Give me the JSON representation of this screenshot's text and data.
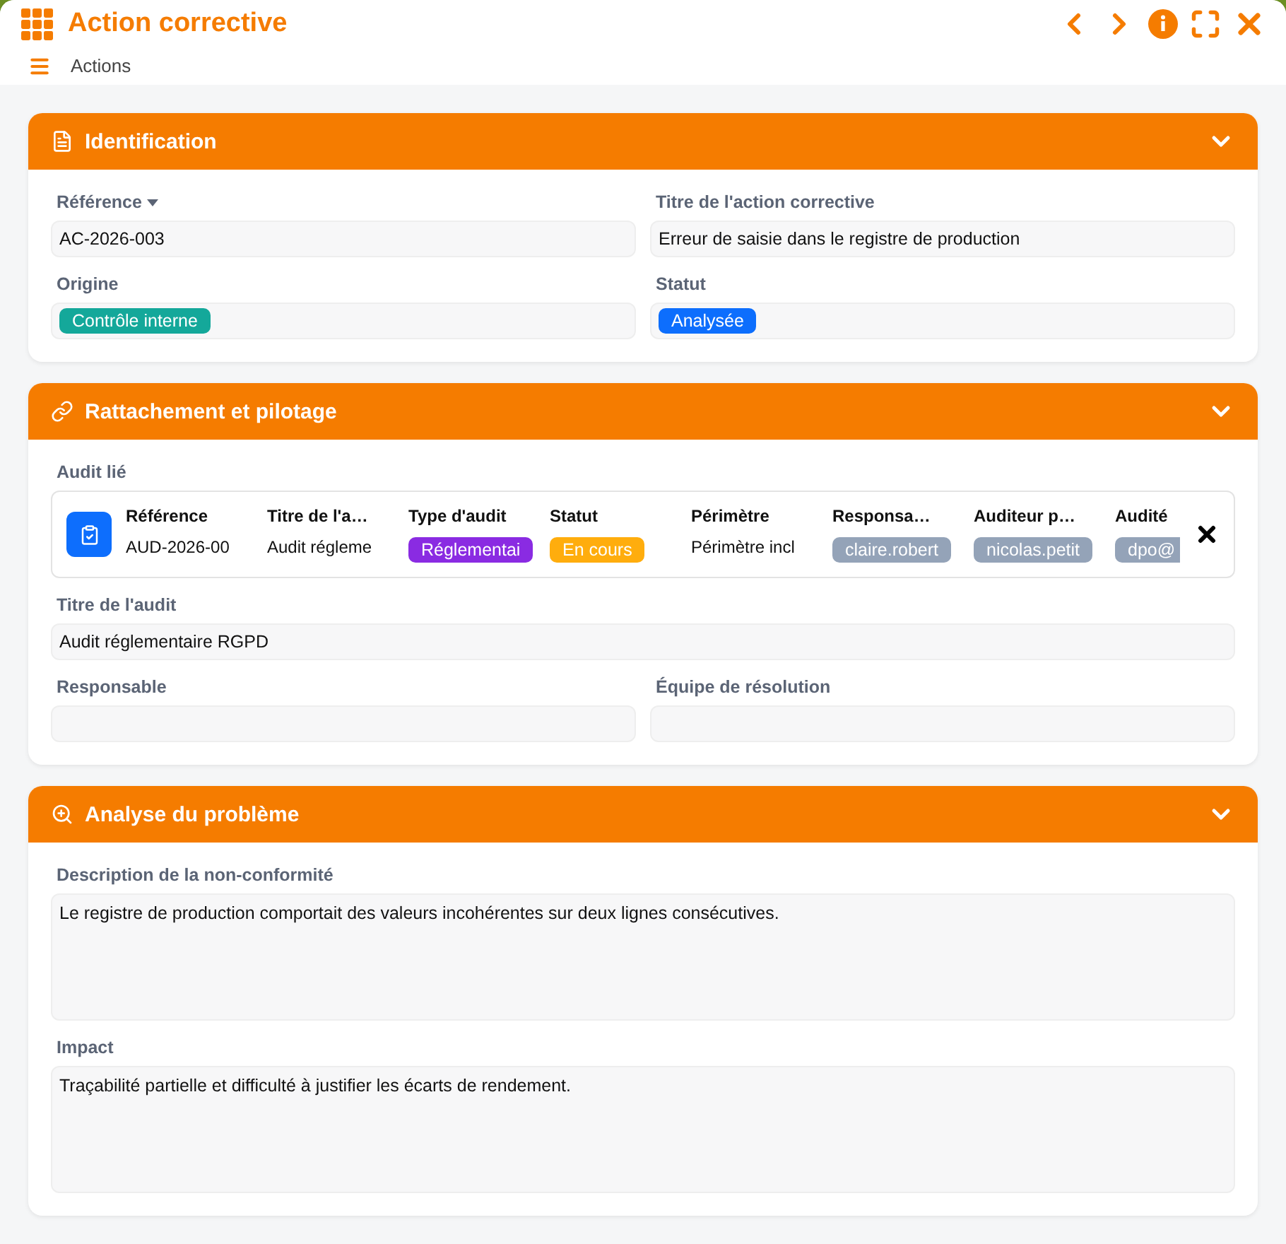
{
  "window": {
    "title": "Action corrective"
  },
  "toolbar": {
    "label": "Actions"
  },
  "sections": [
    {
      "kind": "identification",
      "title": "Identification",
      "expanded": true,
      "fields": [
        {
          "label": "Référence",
          "sortable": true,
          "value": "AC-2026-003",
          "kind": "text"
        },
        {
          "label": "Titre de l'action corrective",
          "value": "Erreur de saisie dans le registre de production",
          "kind": "text"
        },
        {
          "label": "Origine",
          "value": "Contrôle interne",
          "kind": "badge",
          "color": "#14a89a"
        },
        {
          "label": "Statut",
          "value": "Analysée",
          "kind": "badge",
          "color": "#0d6efd"
        }
      ]
    },
    {
      "kind": "link",
      "title": "Rattachement et pilotage",
      "expanded": true,
      "audit": {
        "label": "Audit lié",
        "columns": [
          {
            "header": "Référence",
            "value": "AUD-2026-00",
            "kind": "text"
          },
          {
            "header": "Titre de l'a…",
            "value": "Audit régleme",
            "kind": "text"
          },
          {
            "header": "Type d'audit",
            "value": "Réglementai",
            "kind": "badge",
            "color": "#8a2be2"
          },
          {
            "header": "Statut",
            "value": "En cours",
            "kind": "badge",
            "color": "#ffad0d"
          },
          {
            "header": "Périmètre",
            "value": "Périmètre incl",
            "kind": "text"
          },
          {
            "header": "Responsa…",
            "value": "claire.robert",
            "kind": "badge",
            "color": "#94a3b8"
          },
          {
            "header": "Auditeur p…",
            "value": "nicolas.petit",
            "kind": "badge",
            "color": "#94a3b8"
          },
          {
            "header": "Audité",
            "value": "dpo@",
            "kind": "badge",
            "color": "#94a3b8"
          }
        ]
      },
      "fields": [
        {
          "label": "Titre de l'audit",
          "value": "Audit réglementaire RGPD",
          "kind": "text",
          "wide": true
        },
        {
          "label": "Responsable",
          "kind": "text"
        },
        {
          "label": "Équipe de résolution",
          "kind": "text"
        }
      ]
    },
    {
      "kind": "analysis",
      "title": "Analyse du problème",
      "expanded": true,
      "fields": [
        {
          "label": "Description de la non-conformité",
          "value": "Le registre de production comportait des valeurs incohérentes sur deux lignes consécutives.",
          "kind": "area",
          "wide": true
        },
        {
          "label": "Impact",
          "value": "Traçabilité partielle et difficulté à justifier les écarts de rendement.",
          "kind": "area",
          "wide": true
        }
      ]
    }
  ]
}
